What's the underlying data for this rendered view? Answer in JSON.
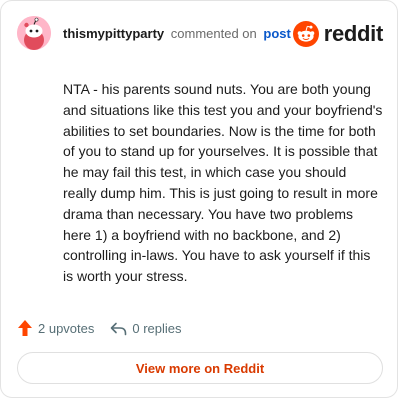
{
  "comment": {
    "author": "thismypittyparty",
    "action": "commented on",
    "target": "post",
    "body": "NTA - his parents sound nuts. You are both young and situations like this test you and your boyfriend's abilities to set boundaries. Now is the time for both of you to stand up for yourselves. It is possible that he may fail this test, in which case you should really dump him. This is just going to result in more drama than necessary. You have two problems here 1) a boyfriend with no backbone, and 2) controlling in-laws. You have to ask yourself if this is worth your stress."
  },
  "brand": {
    "name": "reddit",
    "icon": "reddit-logo-icon",
    "color": "#ff4500"
  },
  "avatar": {
    "icon": "snoo-avatar-icon",
    "background": "#ffb6c8"
  },
  "stats": {
    "upvotes": "2 upvotes",
    "upvote_icon": "upvote-arrow-icon",
    "upvote_color": "#ff4500",
    "replies": "0 replies",
    "reply_icon": "reply-arrow-icon"
  },
  "actions": {
    "view_more": "View more on Reddit",
    "view_more_color": "#d93a00"
  }
}
